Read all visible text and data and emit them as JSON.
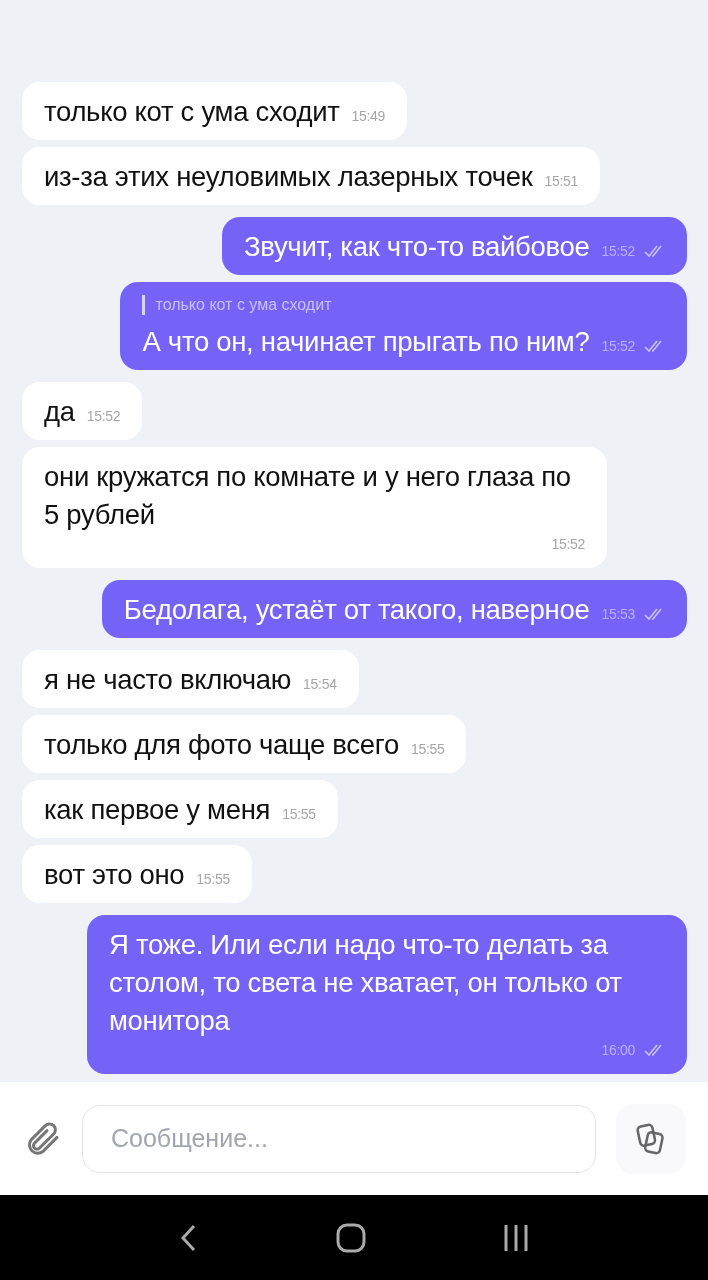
{
  "messages": [
    {
      "kind": "in",
      "text": "только кот с ума сходит",
      "time": "15:49"
    },
    {
      "kind": "in",
      "text": "из-за этих неуловимых лазерных точек",
      "time": "15:51"
    },
    {
      "kind": "out",
      "text": "Звучит, как что-то вайбовое",
      "time": "15:52",
      "read": true
    },
    {
      "kind": "out",
      "reply": "только кот с ума сходит",
      "text": "А что он, начинает прыгать по ним?",
      "time": "15:52",
      "read": true
    },
    {
      "kind": "in",
      "text": "да",
      "time": "15:52"
    },
    {
      "kind": "in",
      "text": "они кружатся по комнате и у него глаза по 5 рублей",
      "time": "15:52"
    },
    {
      "kind": "out",
      "text": "Бедолага, устаёт от такого, наверное",
      "time": "15:53",
      "read": true
    },
    {
      "kind": "in",
      "text": "я не часто включаю",
      "time": "15:54"
    },
    {
      "kind": "in",
      "text": "только для фото чаще всего",
      "time": "15:55"
    },
    {
      "kind": "in",
      "text": "как первое у меня",
      "time": "15:55"
    },
    {
      "kind": "in",
      "text": "вот это оно",
      "time": "15:55"
    },
    {
      "kind": "out",
      "text": "Я тоже. Или если надо что-то делать за столом, то света не хватает, он только от монитора",
      "time": "16:00",
      "read": true
    }
  ],
  "composer": {
    "placeholder": "Сообщение..."
  }
}
